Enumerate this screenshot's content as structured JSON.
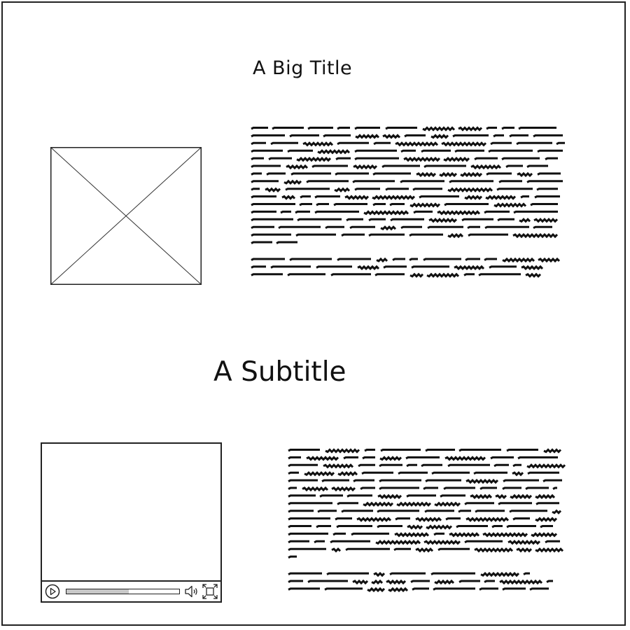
{
  "page": {
    "title": "A Big Title",
    "subtitle": "A Subtitle"
  },
  "section1": {
    "image_icon": "image-placeholder-icon"
  },
  "section2": {
    "video": {
      "play_icon": "play-icon",
      "volume_icon": "volume-icon",
      "fullscreen_icon": "fullscreen-icon",
      "progress_fraction": 0.55
    }
  },
  "colors": {
    "stroke": "#222222",
    "text": "#111111",
    "progress_fill": "#c8c8c8"
  }
}
